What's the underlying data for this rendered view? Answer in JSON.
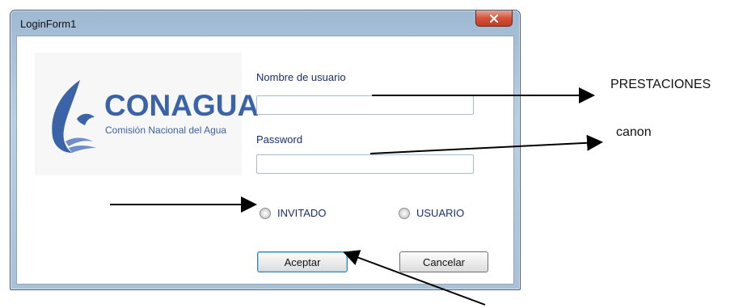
{
  "window": {
    "title": "LoginForm1",
    "close_glyph": "x"
  },
  "logo": {
    "brand": "CONAGUA",
    "tagline": "Comisión Nacional del Agua",
    "icon": "conagua-logo-icon"
  },
  "form": {
    "username_label": "Nombre de usuario",
    "username_value": "",
    "password_label": "Password",
    "password_value": ""
  },
  "radios": [
    {
      "label": "INVITADO",
      "selected": false
    },
    {
      "label": "USUARIO",
      "selected": false
    }
  ],
  "buttons": {
    "accept": "Aceptar",
    "cancel": "Cancelar"
  },
  "annotations": {
    "username_arrow": "PRESTACIONES",
    "password_arrow": "canon"
  },
  "colors": {
    "brand_blue": "#3b63a8",
    "label_blue": "#1a2e6f",
    "close_red": "#c03c22"
  }
}
